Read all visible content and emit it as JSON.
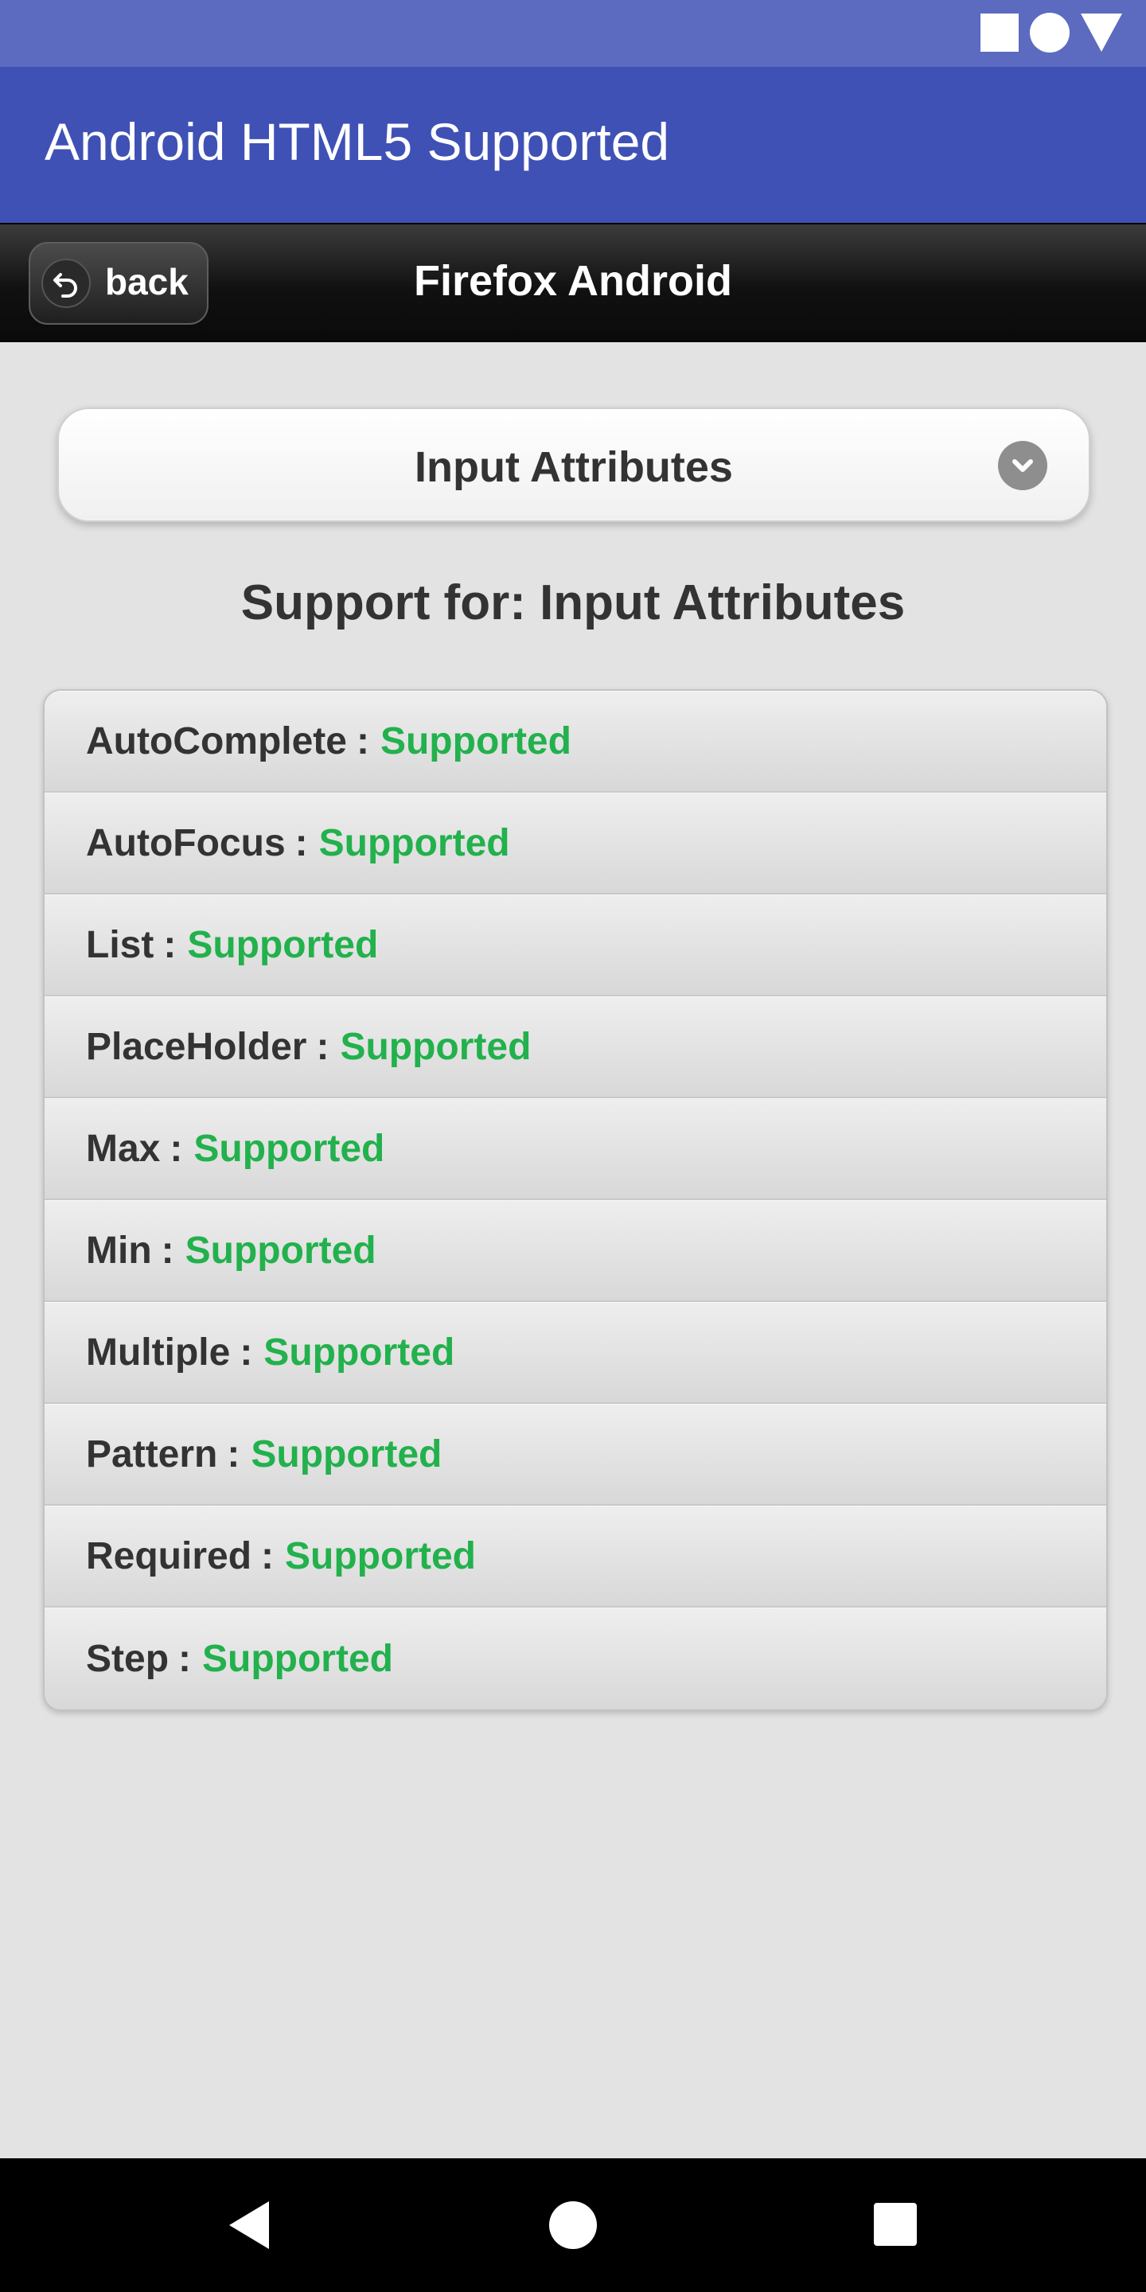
{
  "status_bar": {
    "icons": [
      "stop-square-icon",
      "record-circle-icon",
      "signal-triangle-icon"
    ]
  },
  "app_bar": {
    "title": "Android HTML5 Supported",
    "color": "#3f51b5"
  },
  "header": {
    "back_label": "back",
    "back_icon": "undo-arrow-icon",
    "title": "Firefox Android"
  },
  "selector": {
    "selected": "Input Attributes",
    "icon": "chevron-down-icon"
  },
  "heading": "Support for: Input Attributes",
  "attributes": [
    {
      "name": "AutoComplete",
      "sep": ":",
      "status": "Supported"
    },
    {
      "name": "AutoFocus",
      "sep": ":",
      "status": "Supported"
    },
    {
      "name": "List",
      "sep": ":",
      "status": "Supported"
    },
    {
      "name": "PlaceHolder",
      "sep": ":",
      "status": "Supported"
    },
    {
      "name": "Max",
      "sep": ":",
      "status": "Supported"
    },
    {
      "name": "Min",
      "sep": ":",
      "status": "Supported"
    },
    {
      "name": "Multiple",
      "sep": ":",
      "status": "Supported"
    },
    {
      "name": "Pattern",
      "sep": ":",
      "status": "Supported"
    },
    {
      "name": "Required",
      "sep": ":",
      "status": "Supported"
    },
    {
      "name": "Step",
      "sep": ":",
      "status": "Supported"
    }
  ],
  "colors": {
    "supported": "#22b14c",
    "status_bar": "#5c6bc0"
  },
  "nav_bar": {
    "icons": [
      "back-triangle-icon",
      "home-circle-icon",
      "recents-square-icon"
    ]
  }
}
